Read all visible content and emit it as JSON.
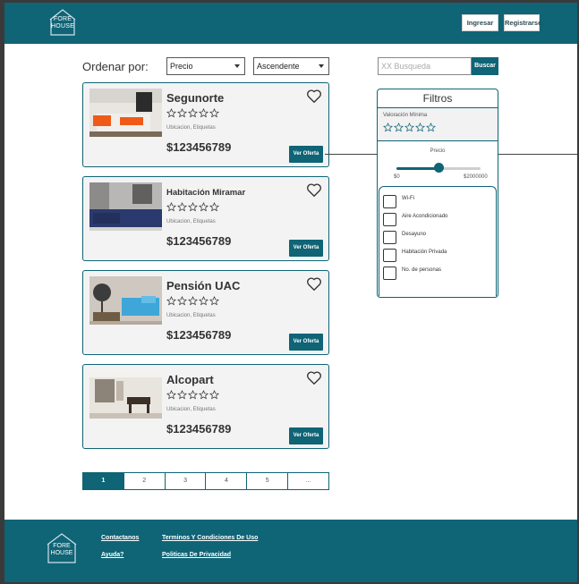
{
  "brand": {
    "logo_line1": "FORE",
    "logo_line2": "HOUSE"
  },
  "header": {
    "login_label": "Ingresar",
    "register_label": "Registrarse"
  },
  "sort": {
    "label": "Ordenar por:",
    "field_value": "Precio",
    "order_value": "Ascendente"
  },
  "search": {
    "placeholder": "XX Busqueda",
    "button_label": "Buscar"
  },
  "listings": [
    {
      "title": "Segunorte",
      "meta": "Ubicacion, Etiquetas",
      "price": "$123456789",
      "button_label": "Ver Oferta",
      "rating": 0
    },
    {
      "title": "Habitación Miramar",
      "meta": "Ubicacion, Etiquetas",
      "price": "$123456789",
      "button_label": "Ver Oferta",
      "rating": 0
    },
    {
      "title": "Pensión UAC",
      "meta": "Ubicacion, Etiquetas",
      "price": "$123456789",
      "button_label": "Ver Oferta",
      "rating": 0
    },
    {
      "title": "Alcopart",
      "meta": "Ubicacion, Etiquetas",
      "price": "$123456789",
      "button_label": "Ver Oferta",
      "rating": 0
    }
  ],
  "filters": {
    "title": "Filtros",
    "rating_label": "Valoración Mínima",
    "rating_value": 0,
    "price_label": "Precio",
    "price_min": "$0",
    "price_max": "$2000000",
    "price_slider_fraction": 0.5,
    "amenities": [
      {
        "label": "Wi-Fi",
        "checked": false
      },
      {
        "label": "Aire Acondicionado",
        "checked": false
      },
      {
        "label": "Desayuno",
        "checked": false
      },
      {
        "label": "Habitación Privada",
        "checked": false
      },
      {
        "label": "No. de personas",
        "checked": false
      }
    ]
  },
  "pagination": {
    "pages": [
      "1",
      "2",
      "3",
      "4",
      "5",
      "..."
    ],
    "current": "1"
  },
  "footer": {
    "contact": "Contactanos",
    "help": "Ayuda?",
    "terms": "Terminos Y Condiciones De Uso",
    "privacy": "Politicas De Privacidad"
  },
  "colors": {
    "primary": "#0f6476",
    "card_bg": "#f3f3f3",
    "page_bg": "#ffffff"
  }
}
